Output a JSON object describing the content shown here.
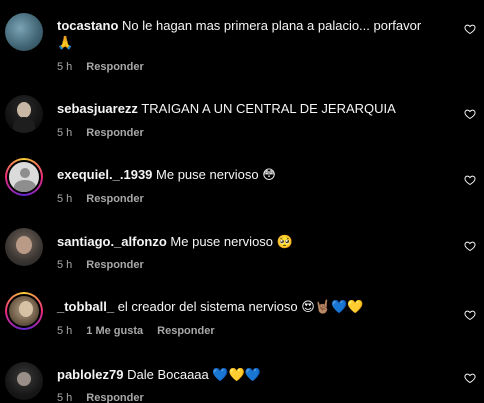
{
  "comments": [
    {
      "username": "tocastano",
      "text": "No le hagan mas primera plana a palacio... porfavor",
      "emoji": "🙏",
      "time": "5 h",
      "likes": "",
      "reply": "Responder"
    },
    {
      "username": "sebasjuarezz",
      "text": "TRAIGAN A UN CENTRAL DE JERARQUIA",
      "time": "5 h",
      "reply": "Responder"
    },
    {
      "username": "exequiel._.1939",
      "text": "Me puse nervioso",
      "emoji": "😳",
      "time": "5 h",
      "reply": "Responder"
    },
    {
      "username": "santiago._alfonzo",
      "text": "Me puse nervioso",
      "emoji": "🥺",
      "time": "5 h",
      "reply": "Responder"
    },
    {
      "username": "_tobball_",
      "text": "el creador del sistema nervioso",
      "emoji": "😍🤘🏽💙💛",
      "time": "5 h",
      "likes": "1 Me gusta",
      "reply": "Responder"
    },
    {
      "username": "pablolez79",
      "text": "Dale Bocaaaa",
      "emoji": "💙💛💙",
      "time": "5 h",
      "reply": "Responder"
    }
  ],
  "icons": {
    "like": "heart-outline-icon"
  }
}
